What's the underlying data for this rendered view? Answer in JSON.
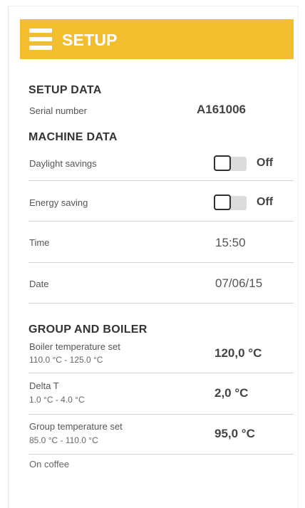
{
  "header": {
    "title": "SETUP"
  },
  "setup_data": {
    "title": "SETUP DATA",
    "serial_label": "Serial number",
    "serial_value": "A161006"
  },
  "machine_data": {
    "title": "MACHINE DATA",
    "daylight_label": "Daylight savings",
    "daylight_state": "Off",
    "energy_label": "Energy saving",
    "energy_state": "Off",
    "time_label": "Time",
    "time_value": "15:50",
    "date_label": "Date",
    "date_value": "07/06/15"
  },
  "group_boiler": {
    "title": "GROUP AND BOILER",
    "boiler_label": "Boiler temperature set",
    "boiler_range": "110.0 °C - 125.0 °C",
    "boiler_value": "120,0 °C",
    "delta_label": "Delta T",
    "delta_range": "1.0 °C - 4.0 °C",
    "delta_value": "2,0 °C",
    "group_label": "Group temperature set",
    "group_range": "85.0 °C - 110.0 °C",
    "group_value": "95,0 °C",
    "next_label": "On coffee"
  },
  "colors": {
    "header_bg": "#f3be2e",
    "divider": "#d4d4d4",
    "toggle_track": "#dcdcdc"
  }
}
